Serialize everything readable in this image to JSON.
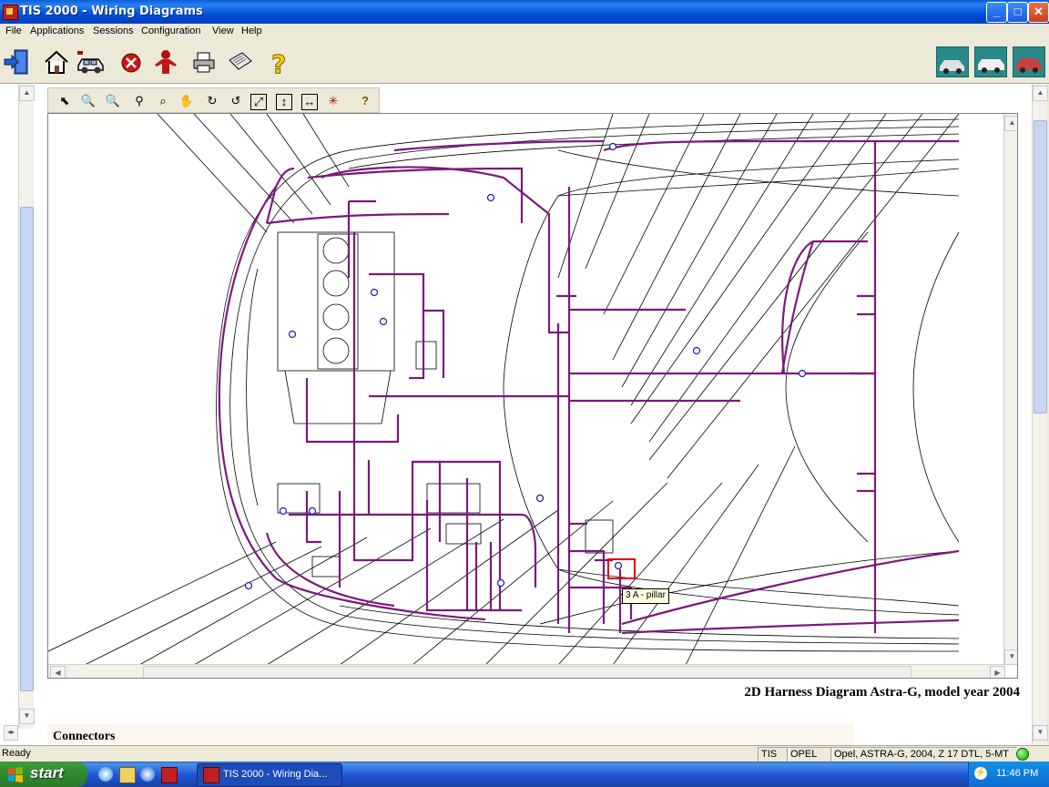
{
  "window": {
    "title": "TIS 2000 - Wiring Diagrams"
  },
  "menu": {
    "items": [
      "File",
      "Applications",
      "Sessions",
      "Configuration",
      "View",
      "Help"
    ]
  },
  "toolbar": {
    "icons": [
      "exit-icon",
      "home-icon",
      "vehicle-icon",
      "stop-icon",
      "person-icon",
      "print-icon",
      "notes-icon",
      "help-icon",
      "vehicle-picture-1-icon",
      "vehicle-picture-2-icon",
      "vehicle-picture-3-icon"
    ]
  },
  "diagram_toolbar": {
    "icons": [
      "select-arrow-icon",
      "zoom-in-icon",
      "zoom-out-icon",
      "zoom-icon",
      "zoom-area-icon",
      "pan-hand-icon",
      "rotate-icon",
      "rotate-back-icon",
      "fit-all-icon",
      "fit-height-icon",
      "fit-width-icon",
      "highlight-icon",
      "help-icon"
    ]
  },
  "diagram": {
    "tooltip": "3 A - pillar",
    "title": "2D Harness Diagram Astra-G, model year 2004",
    "wire_color": "#7b1a7b"
  },
  "sections": {
    "connectors": "Connectors"
  },
  "statusbar": {
    "status": "Ready",
    "panel1": "TIS",
    "panel2": "OPEL",
    "panel3": "Opel, ASTRA-G, 2004, Z 17 DTL, 5-MT"
  },
  "taskbar": {
    "start": "start",
    "task": "TIS 2000 - Wiring Dia...",
    "clock": "11:46 PM"
  }
}
